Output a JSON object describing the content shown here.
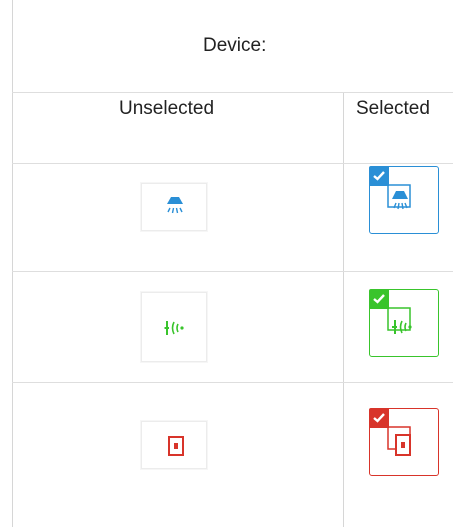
{
  "header": {
    "title": "Device:"
  },
  "columns": {
    "unselected_label": "Unselected",
    "selected_label": "Selected"
  },
  "rows": [
    {
      "device": "light-icon",
      "accent": "#2a8fd6"
    },
    {
      "device": "sensor-icon",
      "accent": "#39c42c"
    },
    {
      "device": "outlet-icon",
      "accent": "#d8342a"
    }
  ],
  "colors": {
    "blue": "#2a8fd6",
    "green": "#39c42c",
    "red": "#d8342a"
  }
}
